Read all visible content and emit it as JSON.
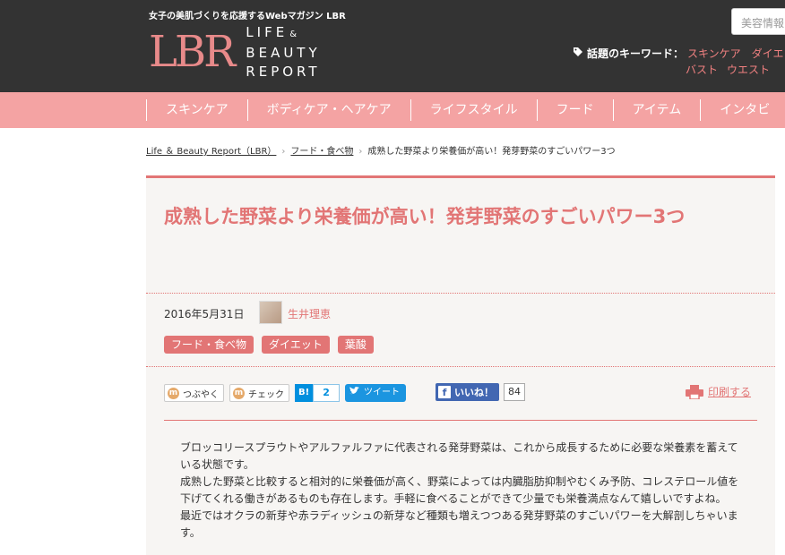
{
  "header": {
    "tagline": "女子の美肌づくりを応援するWebマガジン LBR",
    "logo_mark": "LBR",
    "logo_line1": "LIFE",
    "logo_amp": "&",
    "logo_line2": "BEAUTY",
    "logo_line3": "REPORT",
    "search_placeholder": "美容情報",
    "keywords_label": "話題のキーワード：",
    "keywords": [
      "スキンケア",
      "ダイエ",
      "バスト",
      "ウエスト"
    ]
  },
  "nav": {
    "items": [
      "スキンケア",
      "ボディケア・ヘアケア",
      "ライフスタイル",
      "フード",
      "アイテム",
      "インタビ"
    ]
  },
  "breadcrumb": {
    "home": "Life ＆ Beauty Report（LBR）",
    "category": "フード・食べ物",
    "current": "成熟した野菜より栄養価が高い！発芽野菜のすごいパワー3つ"
  },
  "article": {
    "title": "成熟した野菜より栄養価が高い！発芽野菜のすごいパワー3つ",
    "date": "2016年5月31日",
    "author": "生井理恵",
    "tags": [
      "フード・食べ物",
      "ダイエット",
      "葉酸"
    ],
    "paragraphs": [
      "ブロッコリースプラウトやアルファルファに代表される発芽野菜は、これから成長するために必要な栄養素を蓄えている状態です。",
      "成熟した野菜と比較すると相対的に栄養価が高く、野菜によっては内臓脂肪抑制やむくみ予防、コレステロール値を下げてくれる働きがあるものも存在します。手軽に食べることができて少量でも栄養満点なんて嬉しいですよね。",
      "最近ではオクラの新芽や赤ラディッシュの新芽など種類も増えつつある発芽野菜のすごいパワーを大解剖しちゃいます。"
    ]
  },
  "share": {
    "m_icon": "m",
    "tsubuyaku": "つぶやく",
    "check": "チェック",
    "hatena_label": "B!",
    "hatena_count": "2",
    "tweet": "ツイート",
    "fb_icon": "f",
    "fb_like": "いいね！",
    "fb_count": "84",
    "print": "印刷する"
  }
}
